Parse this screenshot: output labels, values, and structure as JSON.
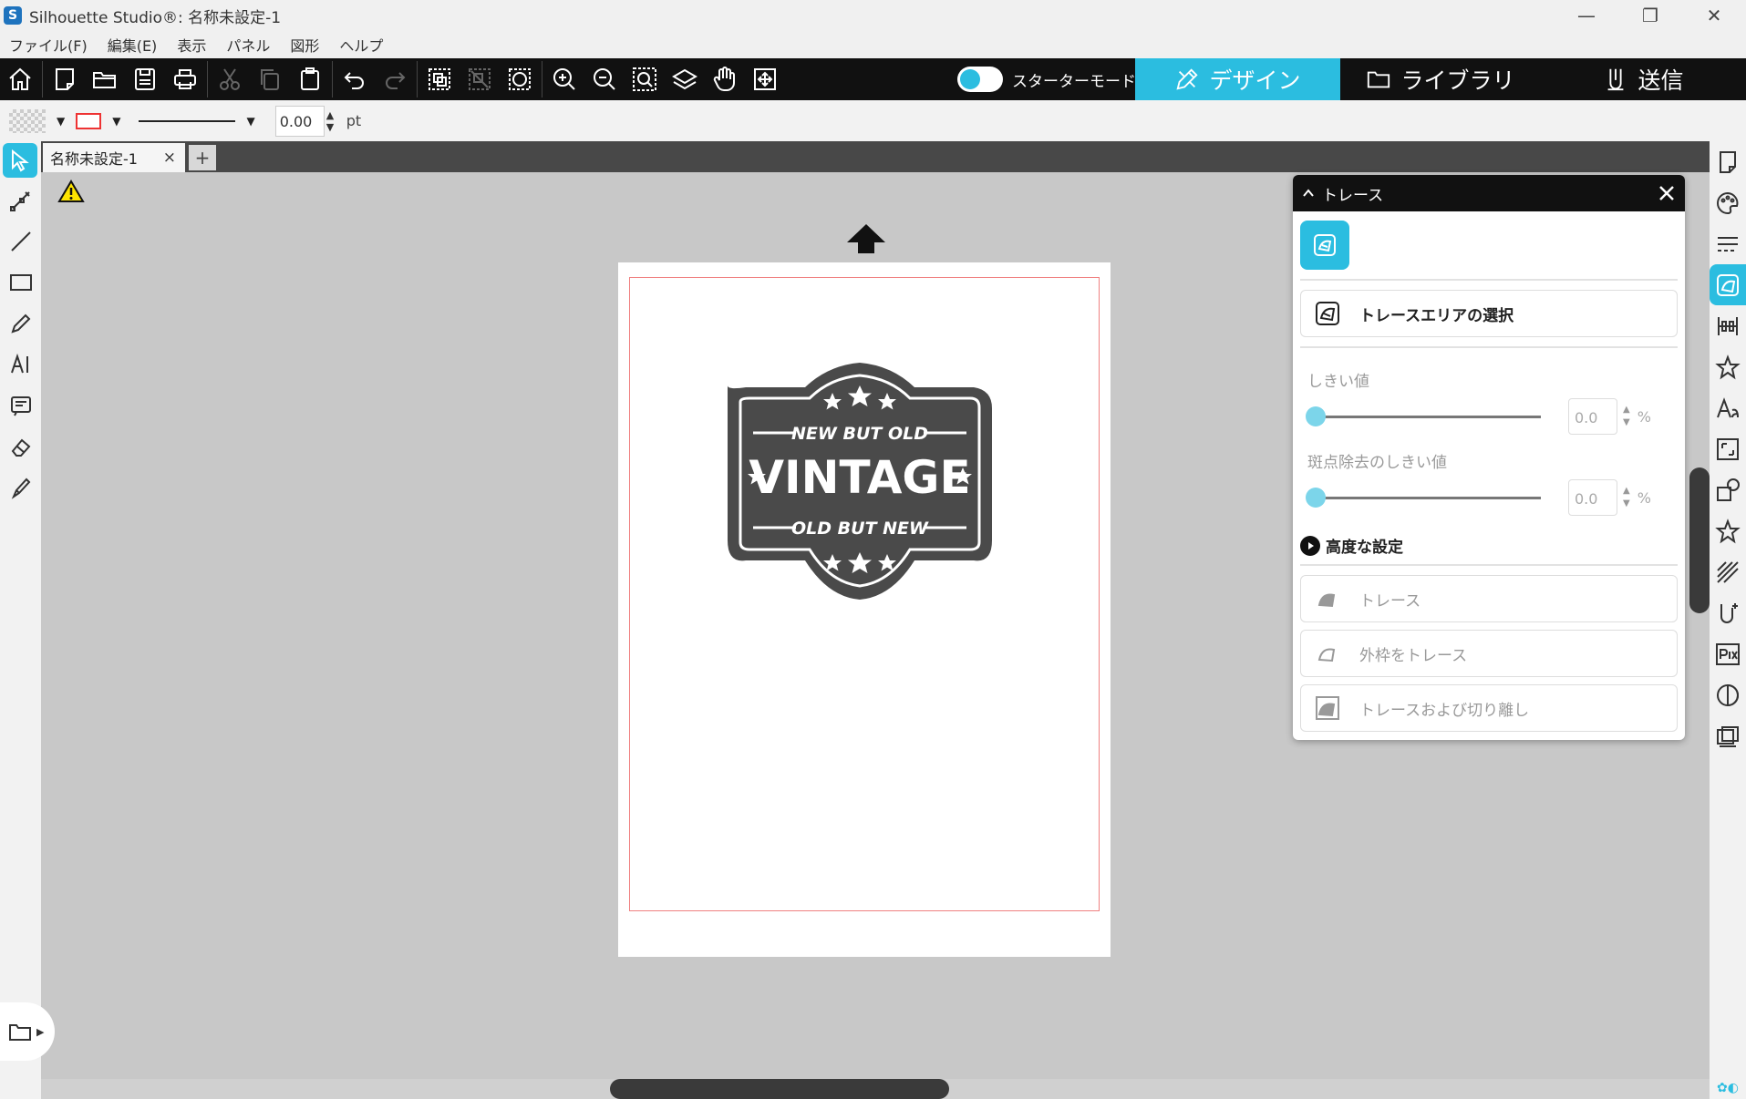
{
  "window": {
    "title": "Silhouette Studio®: 名称未設定-1",
    "app_icon_letter": "S",
    "controls": [
      "—",
      "❐",
      "✕"
    ]
  },
  "menu": [
    "ファイル(F)",
    "編集(E)",
    "表示",
    "パネル",
    "図形",
    "ヘルプ"
  ],
  "toolbar": {
    "starter_mode_label": "スターターモードオフ",
    "tabs": {
      "design": "デザイン",
      "library": "ライブラリ",
      "send": "送信"
    },
    "accent_color": "#2bbde0"
  },
  "properties": {
    "stroke_width": "0.00",
    "unit": "pt",
    "line_color": "#e33333"
  },
  "document": {
    "tab_title": "名称未設定-1",
    "tab_close": "×",
    "add_tab": "+"
  },
  "badge": {
    "top_text": "NEW BUT OLD",
    "main_text": "VINTAGE",
    "bottom_text": "OLD BUT NEW",
    "fill_color": "#4a4a4a"
  },
  "trace_panel": {
    "title": "トレース",
    "select_area_label": "トレースエリアの選択",
    "threshold_label": "しきい値",
    "threshold_value": "0.0",
    "threshold_unit": "%",
    "despeckle_label": "斑点除去のしきい値",
    "despeckle_value": "0.0",
    "despeckle_unit": "%",
    "advanced_label": "高度な設定",
    "trace_label": "トレース",
    "trace_outer_label": "外枠をトレース",
    "trace_detach_label": "トレースおよび切り離し"
  }
}
